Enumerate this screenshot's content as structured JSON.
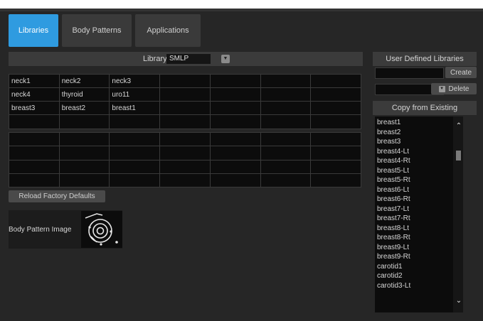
{
  "tabs": [
    {
      "label": "Libraries",
      "active": true
    },
    {
      "label": "Body Patterns",
      "active": false
    },
    {
      "label": "Applications",
      "active": false
    }
  ],
  "library_selector": {
    "label": "Library",
    "value": "SMLP"
  },
  "patterns_grid": {
    "rows": [
      [
        "neck1",
        "neck2",
        "neck3",
        "",
        "",
        "",
        ""
      ],
      [
        "neck4",
        "thyroid",
        "uro11",
        "",
        "",
        "",
        ""
      ],
      [
        "breast3",
        "breast2",
        "breast1",
        "",
        "",
        "",
        ""
      ],
      [
        "",
        "",
        "",
        "",
        "",
        "",
        ""
      ],
      [
        "",
        "",
        "",
        "",
        "",
        "",
        ""
      ],
      [
        "",
        "",
        "",
        "",
        "",
        "",
        ""
      ],
      [
        "",
        "",
        "",
        "",
        "",
        "",
        ""
      ],
      [
        "",
        "",
        "",
        "",
        "",
        "",
        ""
      ]
    ]
  },
  "reload_button": "Reload Factory Defaults",
  "body_pattern_image": {
    "label": "Body Pattern Image"
  },
  "user_defined": {
    "title": "User Defined Libraries",
    "create_label": "Create",
    "delete_label": "Delete"
  },
  "copy_existing": {
    "title": "Copy from Existing",
    "items": [
      "breast1",
      "breast2",
      "breast3",
      "breast4-Lt",
      "breast4-Rt",
      "breast5-Lt",
      "breast5-Rt",
      "breast6-Lt",
      "breast6-Rt",
      "breast7-Lt",
      "breast7-Rt",
      "breast8-Lt",
      "breast8-Rt",
      "breast9-Lt",
      "breast9-Rt",
      "carotid1",
      "carotid2",
      "carotid3-Lt"
    ]
  },
  "colors": {
    "accent": "#2f9be0",
    "panel": "#262626",
    "cell": "#0c0c0c"
  }
}
